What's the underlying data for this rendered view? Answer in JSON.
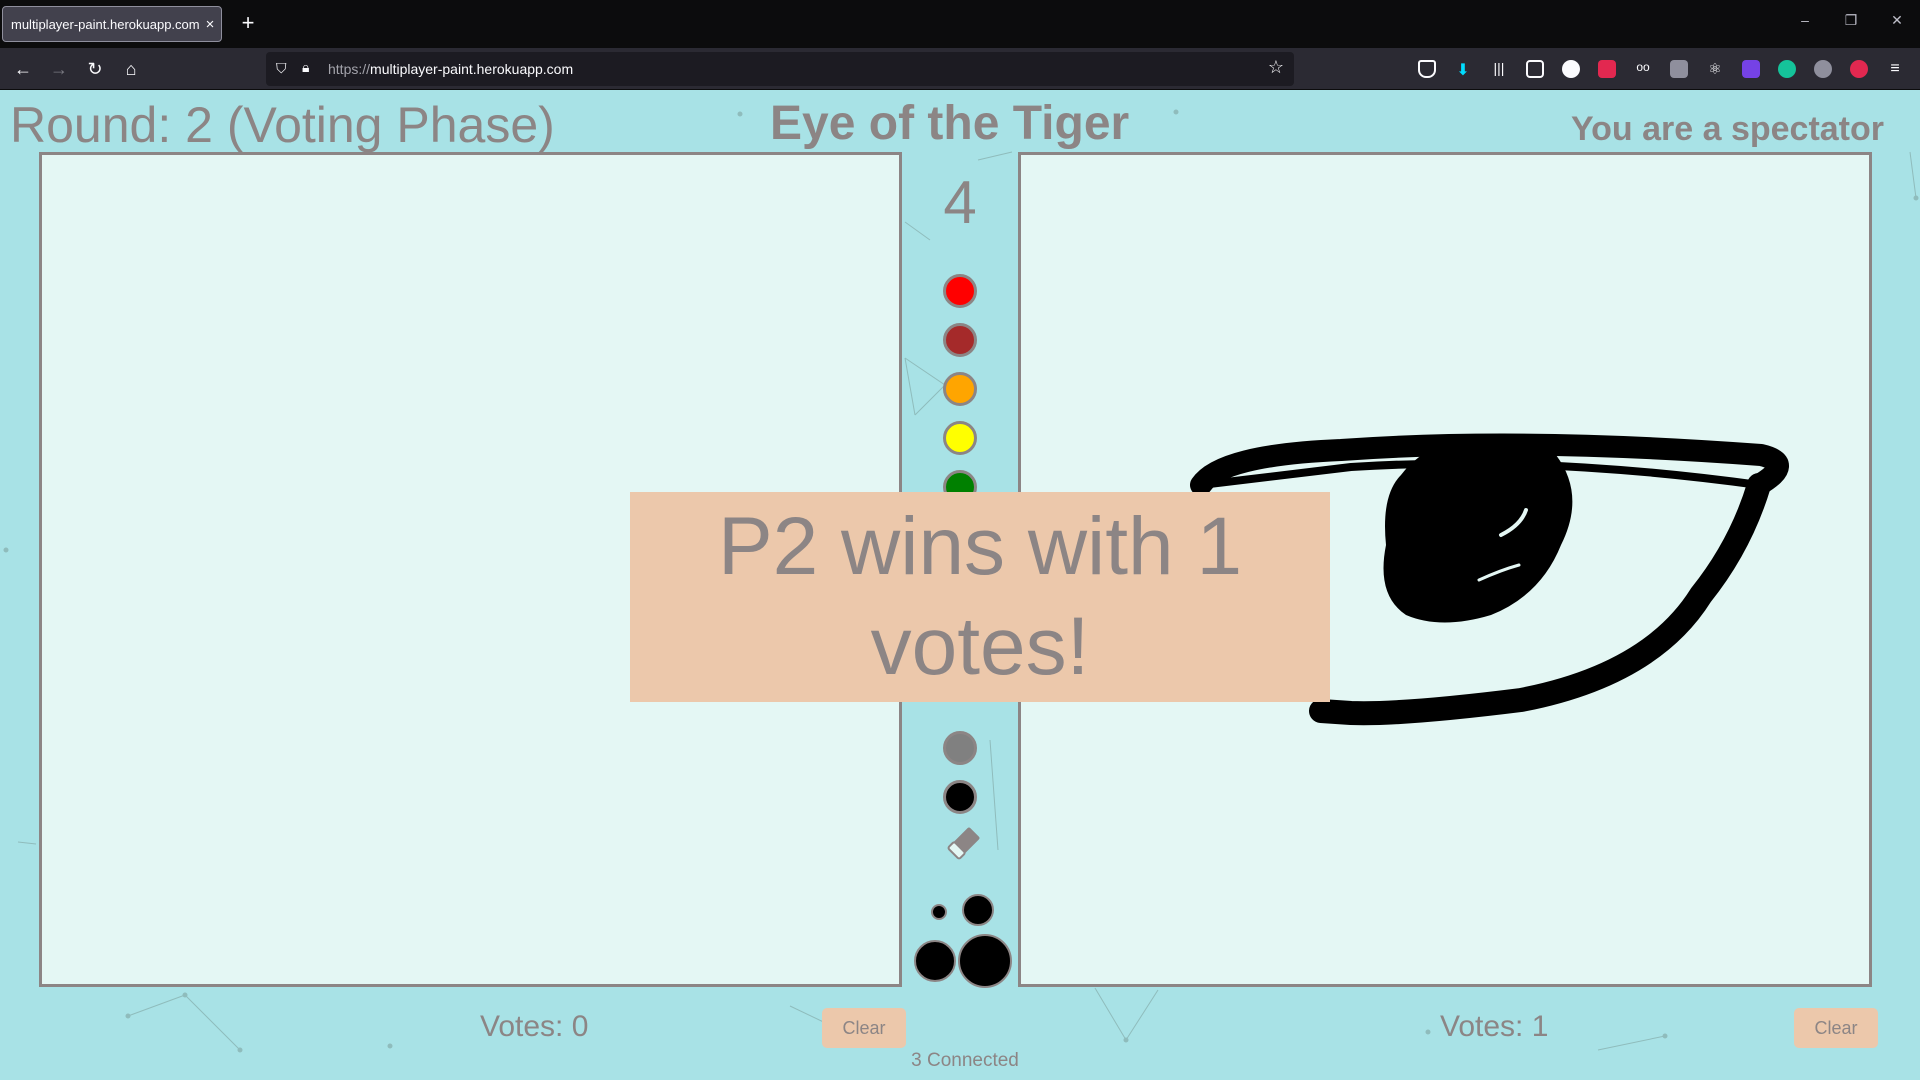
{
  "browser": {
    "tab_title": "multiplayer-paint.herokuapp.com/",
    "tab_close": "×",
    "new_tab": "+",
    "url_protocol": "https://",
    "url_host": "multiplayer-paint.herokuapp.com",
    "window_controls": [
      "–",
      "❐",
      "✕"
    ]
  },
  "game": {
    "round_label": "Round: 2 (Voting Phase)",
    "prompt": "Eye of the Tiger",
    "role": "You are a spectator",
    "timer": "4",
    "colors": [
      "#ff0000",
      "#a52a2a",
      "#ffa500",
      "#ffff00",
      "#008000",
      "#808080",
      "#000000"
    ],
    "left_player": {
      "votes_label": "Votes: 0",
      "clear_label": "Clear"
    },
    "right_player": {
      "votes_label": "Votes: 1",
      "clear_label": "Clear"
    },
    "connected": "3 Connected",
    "result_banner": "P2 wins with 1 votes!"
  }
}
